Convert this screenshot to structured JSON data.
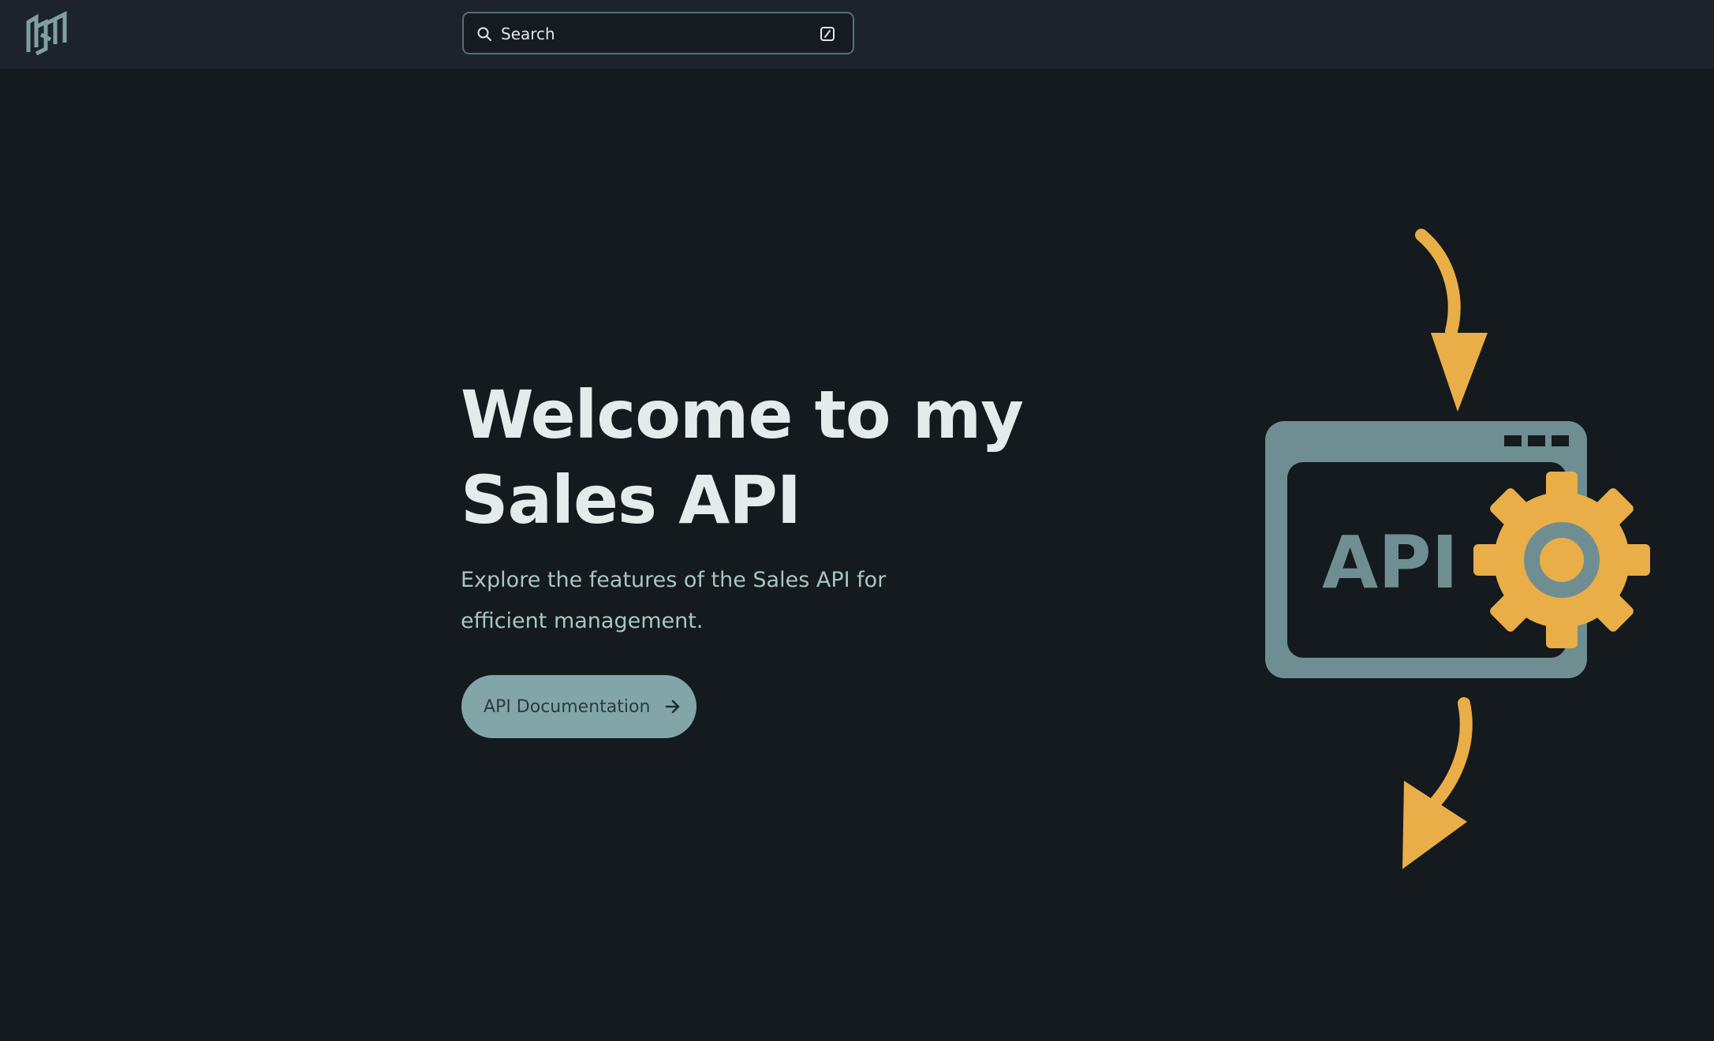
{
  "header": {
    "logo_icon": "nsm-logo-icon",
    "search": {
      "placeholder": "Search",
      "icon": "search-icon",
      "shortcut_icon": "slash-key-icon"
    }
  },
  "hero": {
    "title": "Welcome to my Sales API",
    "subtitle": "Explore the features of the Sales API for efficient management.",
    "cta_label": "API Documentation",
    "cta_icon": "arrow-right-icon",
    "illustration": {
      "icon": "api-gear-illustration",
      "label": "API"
    }
  },
  "colors": {
    "background": "#141a1e",
    "header_bg": "#1c232b",
    "accent": "#82a6a7",
    "illustration_frame": "#6f8e91",
    "illustration_orange": "#e9ae47",
    "title": "#e3ebeb",
    "subtitle": "#a8c6c6"
  }
}
